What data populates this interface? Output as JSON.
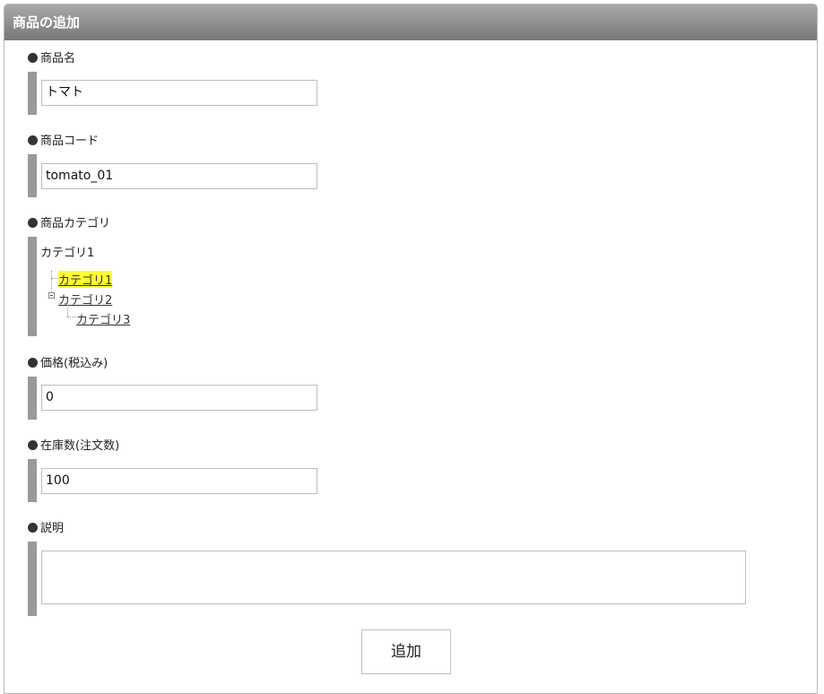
{
  "panel": {
    "title": "商品の追加"
  },
  "fields": {
    "product_name": {
      "label": "商品名",
      "value": "トマト"
    },
    "product_code": {
      "label": "商品コード",
      "value": "tomato_01"
    },
    "category": {
      "label": "商品カテゴリ",
      "selected_text": "カテゴリ1",
      "tree": [
        {
          "label": "カテゴリ1",
          "selected": true,
          "level": 0
        },
        {
          "label": "カテゴリ2",
          "selected": false,
          "level": 0,
          "expanded": true
        },
        {
          "label": "カテゴリ3",
          "selected": false,
          "level": 1
        }
      ]
    },
    "price": {
      "label": "価格(税込み)",
      "value": "0"
    },
    "stock": {
      "label": "在庫数(注文数)",
      "value": "100"
    },
    "description": {
      "label": "説明",
      "value": ""
    }
  },
  "actions": {
    "add_label": "追加"
  },
  "colors": {
    "header_top": "#a9a9a9",
    "header_bottom": "#777777",
    "selection": "#ffff33",
    "bar": "#999999"
  }
}
